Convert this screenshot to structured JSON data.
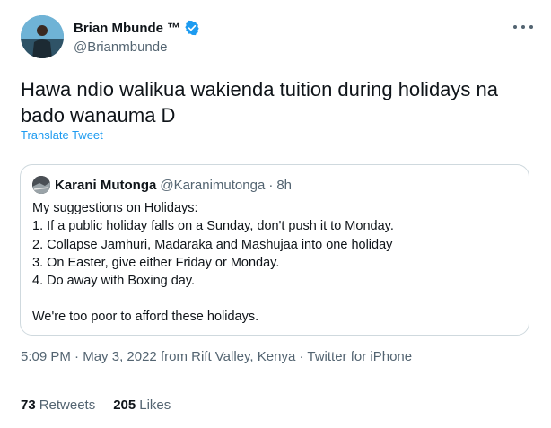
{
  "author": {
    "name": "Brian Mbunde ™",
    "handle": "@Brianmbunde"
  },
  "tweet": {
    "text": "Hawa ndio walikua wakienda tuition during holidays na bado wanauma D",
    "translate_label": "Translate Tweet"
  },
  "quoted": {
    "name": "Karani Mutonga",
    "handle": "@Karanimutonga",
    "time": "8h",
    "lines": [
      "My suggestions on Holidays:",
      "1. If a public holiday falls on a Sunday, don't push it to Monday.",
      "2. Collapse Jamhuri, Madaraka and Mashujaa into one holiday",
      "3. On Easter, give either Friday or Monday.",
      "4. Do away with Boxing day."
    ],
    "closing": "We're too poor to afford these holidays."
  },
  "meta": {
    "time": "5:09 PM",
    "date": "May 3, 2022",
    "location": "from Rift Valley, Kenya",
    "client": "Twitter for iPhone"
  },
  "stats": {
    "retweets_count": "73",
    "retweets_label": "Retweets",
    "likes_count": "205",
    "likes_label": "Likes"
  },
  "icons": {
    "verified": "verified-badge-icon",
    "more": "more-options-icon"
  },
  "colors": {
    "accent": "#1d9bf0",
    "secondary_text": "#536471",
    "primary_text": "#0f1419",
    "border": "#cfd9de"
  }
}
